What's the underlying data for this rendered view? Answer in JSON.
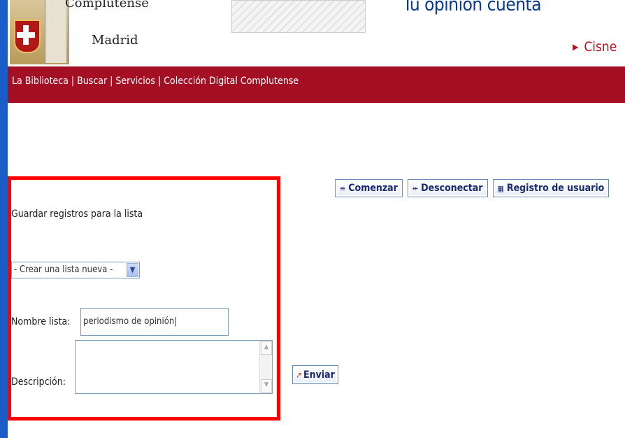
{
  "header": {
    "university_line1": "Complutense",
    "university_line2": "Madrid",
    "banner_text": "Tu opinión cuenta",
    "cisne_link": "Cisne"
  },
  "nav": {
    "items": [
      "La Biblioteca",
      "Buscar",
      "Servicios",
      "Colección Digital Complutense"
    ],
    "separator": " | "
  },
  "toolbar": {
    "comenzar": "Comenzar",
    "desconectar": "Desconectar",
    "registro": "Registro de usuario"
  },
  "form": {
    "heading": "Guardar registros para la lista",
    "list_select_value": "- Crear una lista nueva -",
    "name_label": "Nombre lista:",
    "name_value": "periodismo de opinión",
    "description_label": "Descripción:",
    "description_value": "",
    "submit_label": "Enviar"
  },
  "colors": {
    "nav_background": "#a40f24",
    "highlight_box": "#ff0000",
    "page_background": "#1a5cc8"
  }
}
